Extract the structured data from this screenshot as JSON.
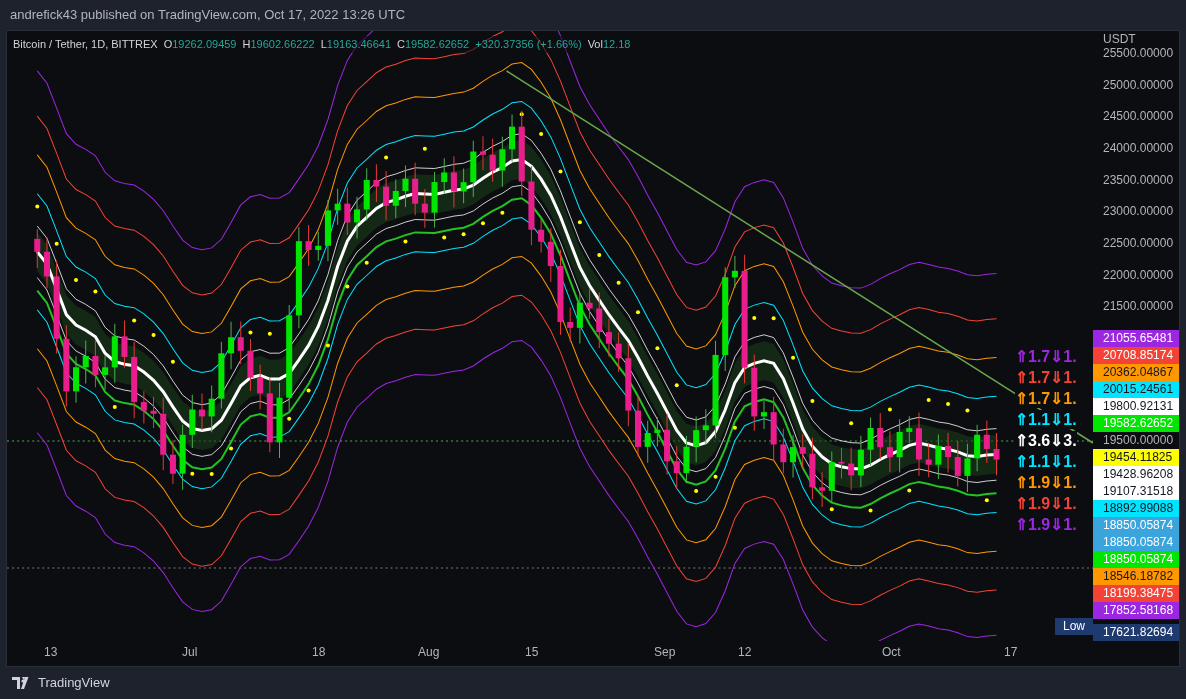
{
  "header": {
    "text": "andrefick43 published on TradingView.com, Oct 17, 2022 13:26 UTC"
  },
  "legend": {
    "symbol": "Bitcoin / Tether, 1D, BITTREX",
    "values": [
      {
        "label": "O",
        "value": "19262.09459"
      },
      {
        "label": "H",
        "value": "19602.66222"
      },
      {
        "label": "L",
        "value": "19163.46641"
      },
      {
        "label": "C",
        "value": "19582.62652"
      }
    ],
    "change": "+320.37356 (+1.66%)",
    "volume_label": "Vol",
    "volume": "12.18"
  },
  "price_axis": {
    "currency": "USDT",
    "ticks": [
      "25500.00000",
      "25000.00000",
      "24500.00000",
      "24000.00000",
      "23500.00000",
      "23000.00000",
      "22500.00000",
      "22000.00000",
      "21500.00000"
    ]
  },
  "price_labels": [
    {
      "value": "21055.65481",
      "color": "#9c27e0"
    },
    {
      "value": "20708.85174",
      "color": "#f44336"
    },
    {
      "value": "20362.04867",
      "color": "#ff9800"
    },
    {
      "value": "20015.24561",
      "color": "#00e5ff"
    },
    {
      "value": "19800.92131",
      "color": "#ffffff"
    },
    {
      "value": "19582.62652",
      "color": "#00e600"
    },
    {
      "value": "19500.00000",
      "color": "#0c0d10"
    },
    {
      "value": "19454.11825",
      "color": "#ffff00"
    },
    {
      "value": "19428.96208",
      "color": "#ffffff"
    },
    {
      "value": "19107.31518",
      "color": "#ffffff"
    },
    {
      "value": "18892.99088",
      "color": "#00e5ff"
    },
    {
      "value": "18850.05874",
      "color": "#3ba4dc"
    },
    {
      "value": "18850.05874",
      "color": "#3ba4dc"
    },
    {
      "value": "18850.05874",
      "color": "#00e600"
    },
    {
      "value": "18546.18782",
      "color": "#ff9800"
    },
    {
      "value": "18199.38475",
      "color": "#f44336"
    },
    {
      "value": "17852.58168",
      "color": "#9c27e0"
    }
  ],
  "low_label": {
    "label": "Low",
    "value": "17621.82694"
  },
  "band_labels": [
    {
      "text": "⇑1.7⇓1.",
      "color": "#9c27e0"
    },
    {
      "text": "⇑1.7⇓1.",
      "color": "#f44336"
    },
    {
      "text": "⇑1.7⇓1.",
      "color": "#ff9800"
    },
    {
      "text": "⇑1.1⇓1.",
      "color": "#00e5ff"
    },
    {
      "text": "⇑3.6⇓3.",
      "color": "#ffffff"
    },
    {
      "text": "⇑1.1⇓1.",
      "color": "#00e5ff"
    },
    {
      "text": "⇑1.9⇓1.",
      "color": "#ff9800"
    },
    {
      "text": "⇑1.9⇓1.",
      "color": "#f44336"
    },
    {
      "text": "⇑1.9⇓1.",
      "color": "#9c27e0"
    }
  ],
  "time_axis": [
    "13",
    "Jul",
    "18",
    "Aug",
    "15",
    "Sep",
    "12",
    "Oct",
    "17"
  ],
  "footer": {
    "brand": "TradingView"
  }
}
